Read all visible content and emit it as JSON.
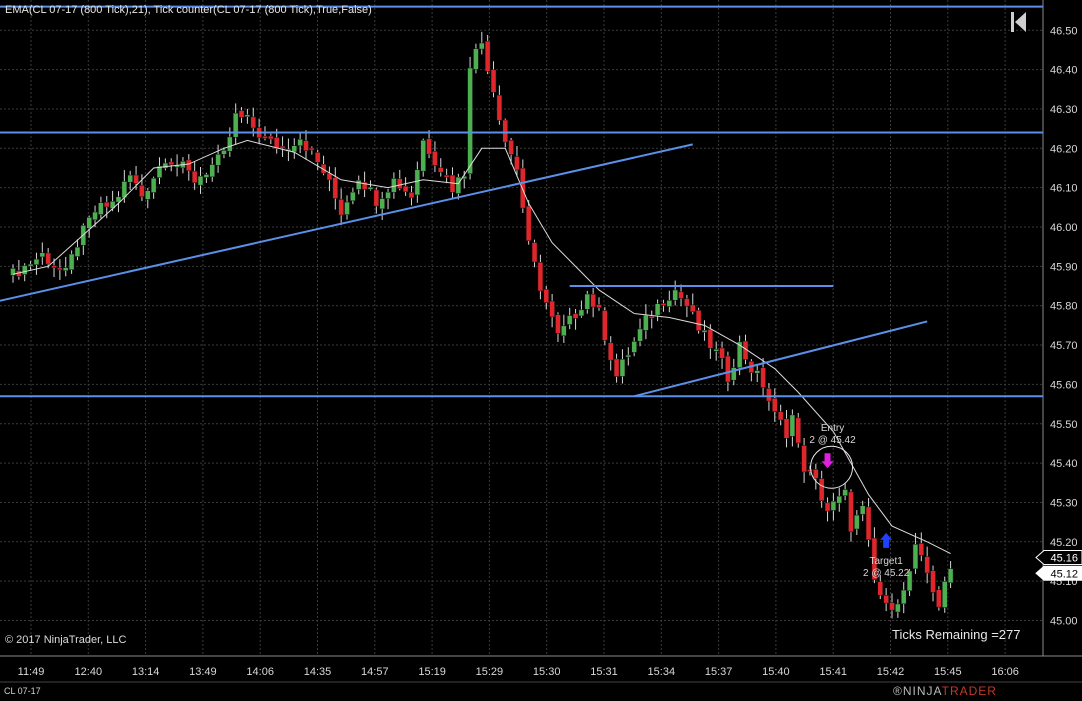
{
  "indicator_label": "EMA(CL 07-17 (800 Tick),21), Tick counter(CL 07-17 (800 Tick),True,False)",
  "copyright": "© 2017 NinjaTrader, LLC",
  "ticks_remaining": "Ticks Remaining =277",
  "instrument_tab": "CL 07-17",
  "logo": {
    "main": "NINJA",
    "accent": "TRADER",
    "mark": "®"
  },
  "colors": {
    "background": "#000000",
    "grid": "#3a3a3a",
    "up": "#4caf50",
    "down": "#e0252b",
    "wick": "#d8d8d8",
    "ema": "#dcdcdc",
    "drawn_lines": "#5b8fe8",
    "price_tag_bg": "#ffffff",
    "entry_arrow": "#e020e0",
    "target_arrow": "#2040ff"
  },
  "icons": {
    "collapse": "skip-to-start-icon"
  },
  "chart_data": {
    "type": "candlestick",
    "ylim": [
      44.96,
      46.56
    ],
    "yticks": [
      "46.50",
      "46.40",
      "46.30",
      "46.20",
      "46.10",
      "46.00",
      "45.90",
      "45.80",
      "45.70",
      "45.60",
      "45.50",
      "45.40",
      "45.30",
      "45.20",
      "45.10",
      "45.00"
    ],
    "xticks": [
      "11:49",
      "12:40",
      "13:14",
      "13:49",
      "14:06",
      "14:35",
      "14:57",
      "15:19",
      "15:29",
      "15:30",
      "15:31",
      "15:34",
      "15:37",
      "15:40",
      "15:41",
      "15:42",
      "15:45",
      "16:06"
    ],
    "n_bars": 161,
    "close_path": [
      [
        0,
        45.88
      ],
      [
        5,
        45.93
      ],
      [
        9,
        45.88
      ],
      [
        11,
        45.96
      ],
      [
        14,
        46.04
      ],
      [
        17,
        46.06
      ],
      [
        20,
        46.13
      ],
      [
        22,
        46.08
      ],
      [
        26,
        46.18
      ],
      [
        29,
        46.15
      ],
      [
        31,
        46.12
      ],
      [
        36,
        46.18
      ],
      [
        38,
        46.28
      ],
      [
        40,
        46.27
      ],
      [
        43,
        46.22
      ],
      [
        46,
        46.2
      ],
      [
        49,
        46.23
      ],
      [
        53,
        46.14
      ],
      [
        56,
        46.04
      ],
      [
        59,
        46.13
      ],
      [
        62,
        46.07
      ],
      [
        65,
        46.12
      ],
      [
        68,
        46.08
      ],
      [
        70,
        46.22
      ],
      [
        73,
        46.15
      ],
      [
        75,
        46.1
      ],
      [
        77,
        46.14
      ],
      [
        78,
        46.42
      ],
      [
        80,
        46.47
      ],
      [
        82,
        46.35
      ],
      [
        84,
        46.22
      ],
      [
        86,
        46.15
      ],
      [
        88,
        45.95
      ],
      [
        90,
        45.85
      ],
      [
        93,
        45.72
      ],
      [
        96,
        45.78
      ],
      [
        98,
        45.83
      ],
      [
        100,
        45.78
      ],
      [
        103,
        45.62
      ],
      [
        105,
        45.68
      ],
      [
        108,
        45.76
      ],
      [
        111,
        45.82
      ],
      [
        113,
        45.84
      ],
      [
        115,
        45.8
      ],
      [
        117,
        45.74
      ],
      [
        120,
        45.68
      ],
      [
        122,
        45.62
      ],
      [
        124,
        45.7
      ],
      [
        126,
        45.64
      ],
      [
        128,
        45.6
      ],
      [
        130,
        45.52
      ],
      [
        132,
        45.48
      ],
      [
        133,
        45.52
      ],
      [
        134,
        45.44
      ],
      [
        135,
        45.39
      ],
      [
        137,
        45.35
      ],
      [
        139,
        45.28
      ],
      [
        142,
        45.32
      ],
      [
        143,
        45.24
      ],
      [
        145,
        45.28
      ],
      [
        147,
        45.1
      ],
      [
        149,
        45.03
      ],
      [
        152,
        45.07
      ],
      [
        154,
        45.18
      ],
      [
        156,
        45.12
      ],
      [
        158,
        45.04
      ],
      [
        160,
        45.13
      ]
    ],
    "ema_path": [
      [
        0,
        45.88
      ],
      [
        6,
        45.9
      ],
      [
        12,
        45.98
      ],
      [
        18,
        46.06
      ],
      [
        24,
        46.15
      ],
      [
        30,
        46.16
      ],
      [
        36,
        46.2
      ],
      [
        40,
        46.22
      ],
      [
        48,
        46.19
      ],
      [
        56,
        46.12
      ],
      [
        64,
        46.1
      ],
      [
        70,
        46.12
      ],
      [
        76,
        46.11
      ],
      [
        80,
        46.2
      ],
      [
        84,
        46.2
      ],
      [
        88,
        46.06
      ],
      [
        92,
        45.96
      ],
      [
        96,
        45.9
      ],
      [
        100,
        45.84
      ],
      [
        106,
        45.78
      ],
      [
        112,
        45.77
      ],
      [
        118,
        45.75
      ],
      [
        124,
        45.7
      ],
      [
        130,
        45.64
      ],
      [
        134,
        45.58
      ],
      [
        140,
        45.48
      ],
      [
        146,
        45.32
      ],
      [
        150,
        45.24
      ],
      [
        156,
        45.2
      ],
      [
        160,
        45.17
      ]
    ],
    "horizontal_lines": [
      46.56,
      46.24,
      45.57
    ],
    "trend_lines": [
      {
        "x1": -3,
        "y1": 45.81,
        "x2": 116,
        "y2": 46.21
      },
      {
        "x1": 95,
        "y1": 45.85,
        "x2": 140,
        "y2": 45.85
      },
      {
        "x1": 106,
        "y1": 45.57,
        "x2": 156,
        "y2": 45.76
      }
    ],
    "price_markers": [
      {
        "label": "45.16",
        "value": 45.16,
        "style": "outline"
      },
      {
        "label": "45.12",
        "value": 45.12,
        "style": "filled"
      }
    ],
    "executions": [
      {
        "name": "entry",
        "label": "Entry",
        "detail": "2 @ 45.42",
        "bar": 139,
        "value": 45.42,
        "direction": "down"
      },
      {
        "name": "target1",
        "label": "Target1",
        "detail": "2 @ 45.22",
        "bar": 149,
        "value": 45.22,
        "direction": "up"
      }
    ]
  }
}
